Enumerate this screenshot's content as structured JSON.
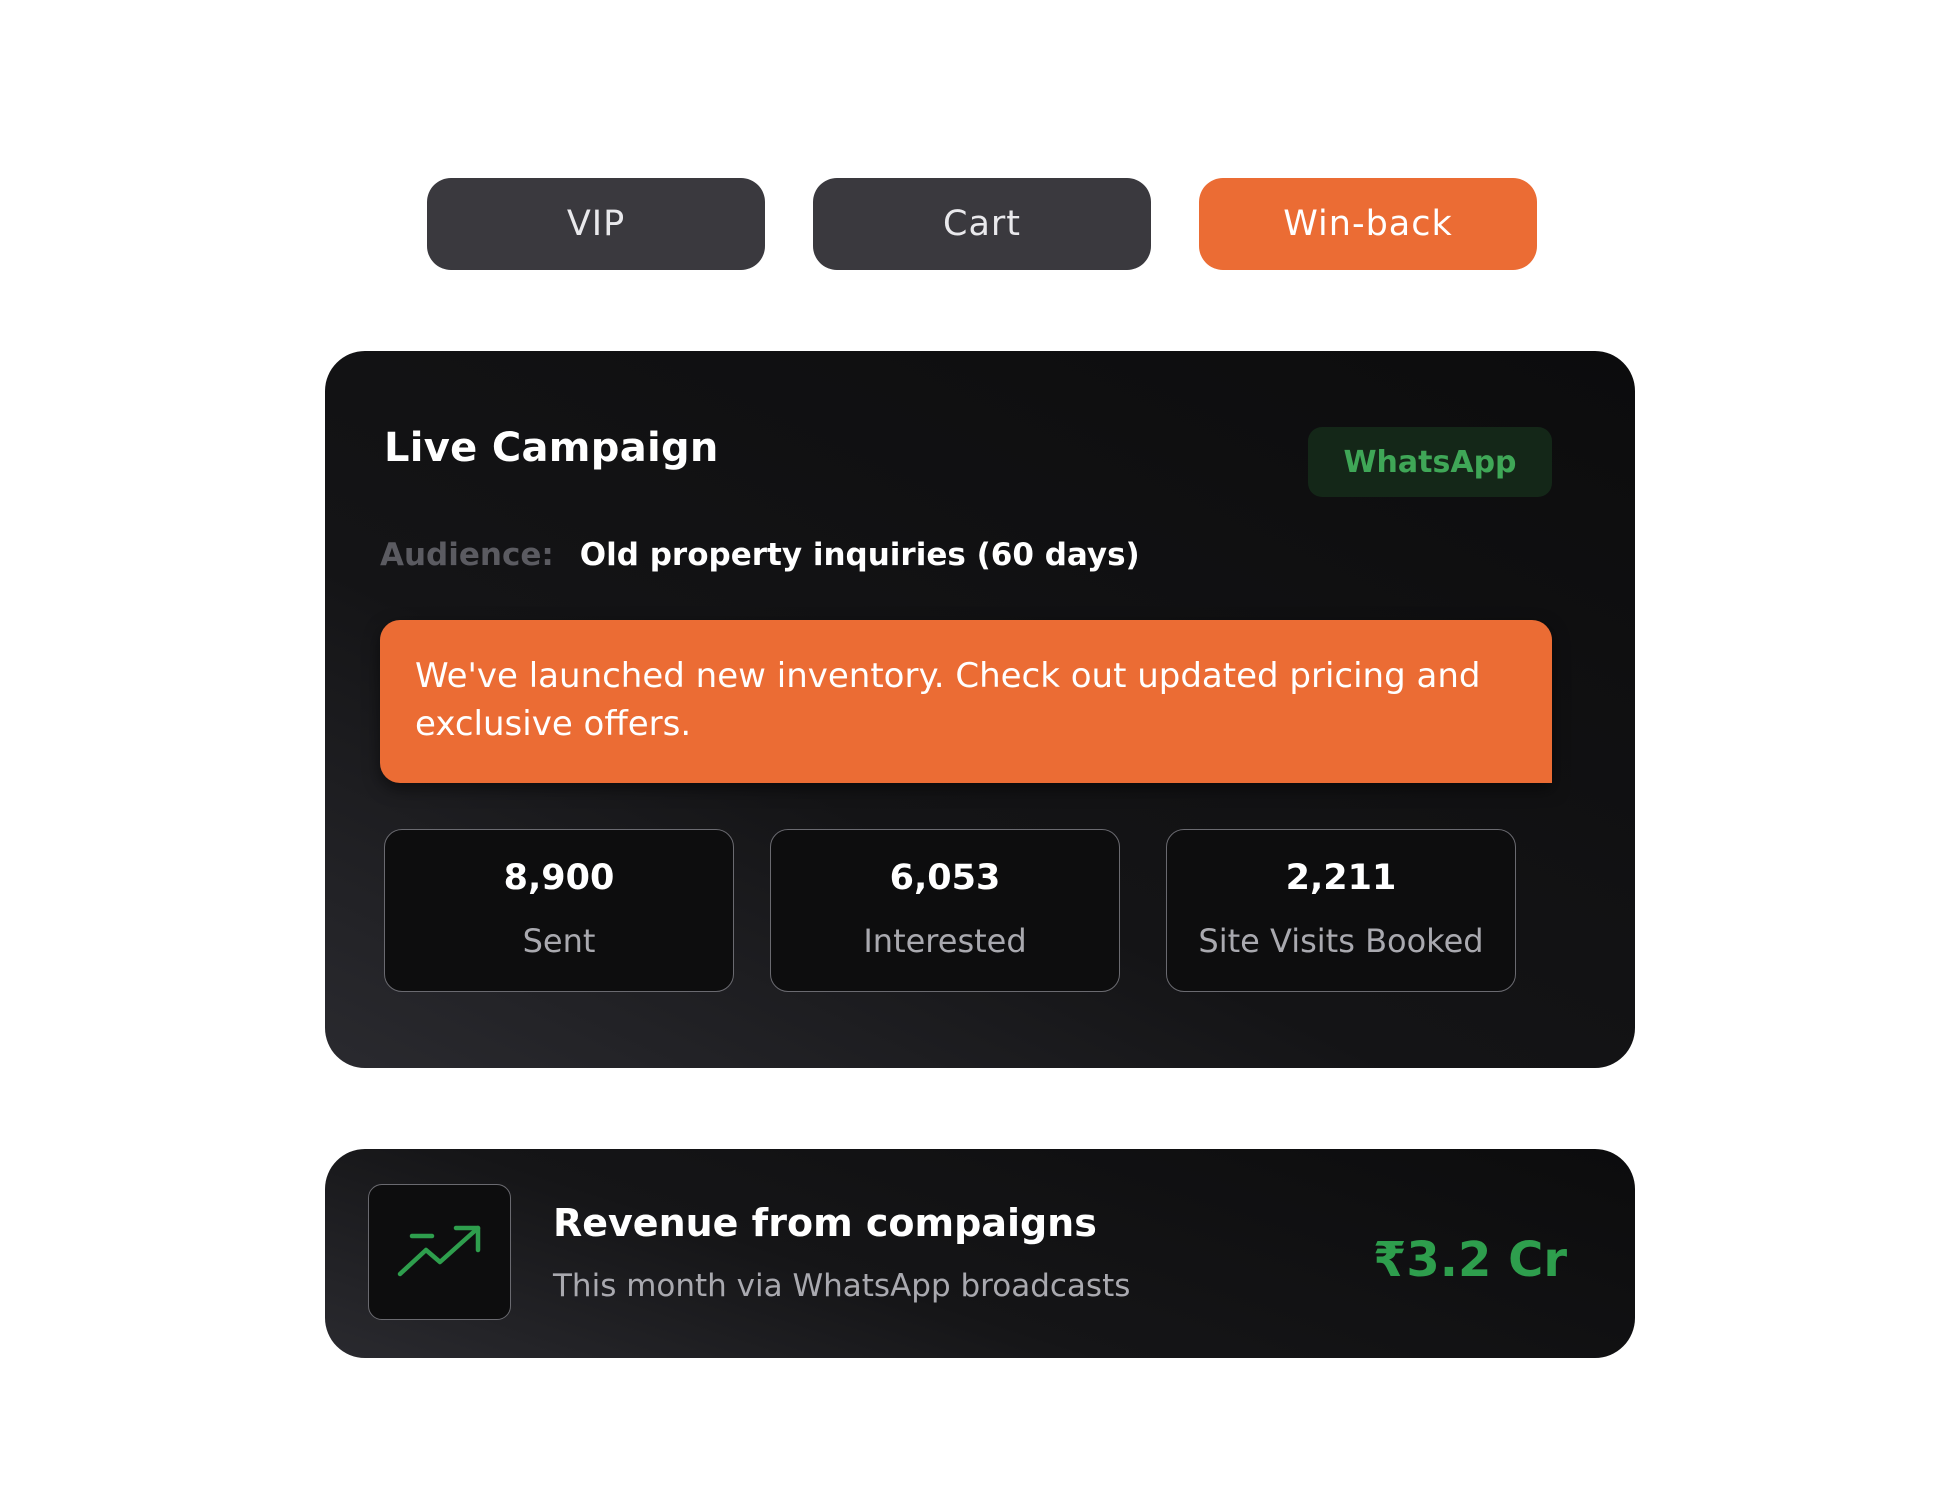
{
  "tabs": [
    {
      "label": "VIP",
      "active": false
    },
    {
      "label": "Cart",
      "active": false
    },
    {
      "label": "Win-back",
      "active": true
    }
  ],
  "campaign": {
    "title": "Live Campaign",
    "channel": "WhatsApp",
    "audience_label": "Audience:",
    "audience_value": "Old property inquiries (60 days)",
    "message": "We've launched new inventory. Check out updated pricing and exclusive offers.",
    "stats": [
      {
        "value": "8,900",
        "label": "Sent"
      },
      {
        "value": "6,053",
        "label": "Interested"
      },
      {
        "value": "2,211",
        "label": "Site Visits Booked"
      }
    ]
  },
  "revenue": {
    "icon": "trending-up-icon",
    "title": "Revenue from compaigns",
    "subtitle": "This month via WhatsApp broadcasts",
    "amount": "₹3.2 Cr"
  },
  "colors": {
    "accent": "#eb6c34",
    "tab_inactive": "#3a393e",
    "positive": "#2e9e4d",
    "card": "#0d0d0e"
  }
}
